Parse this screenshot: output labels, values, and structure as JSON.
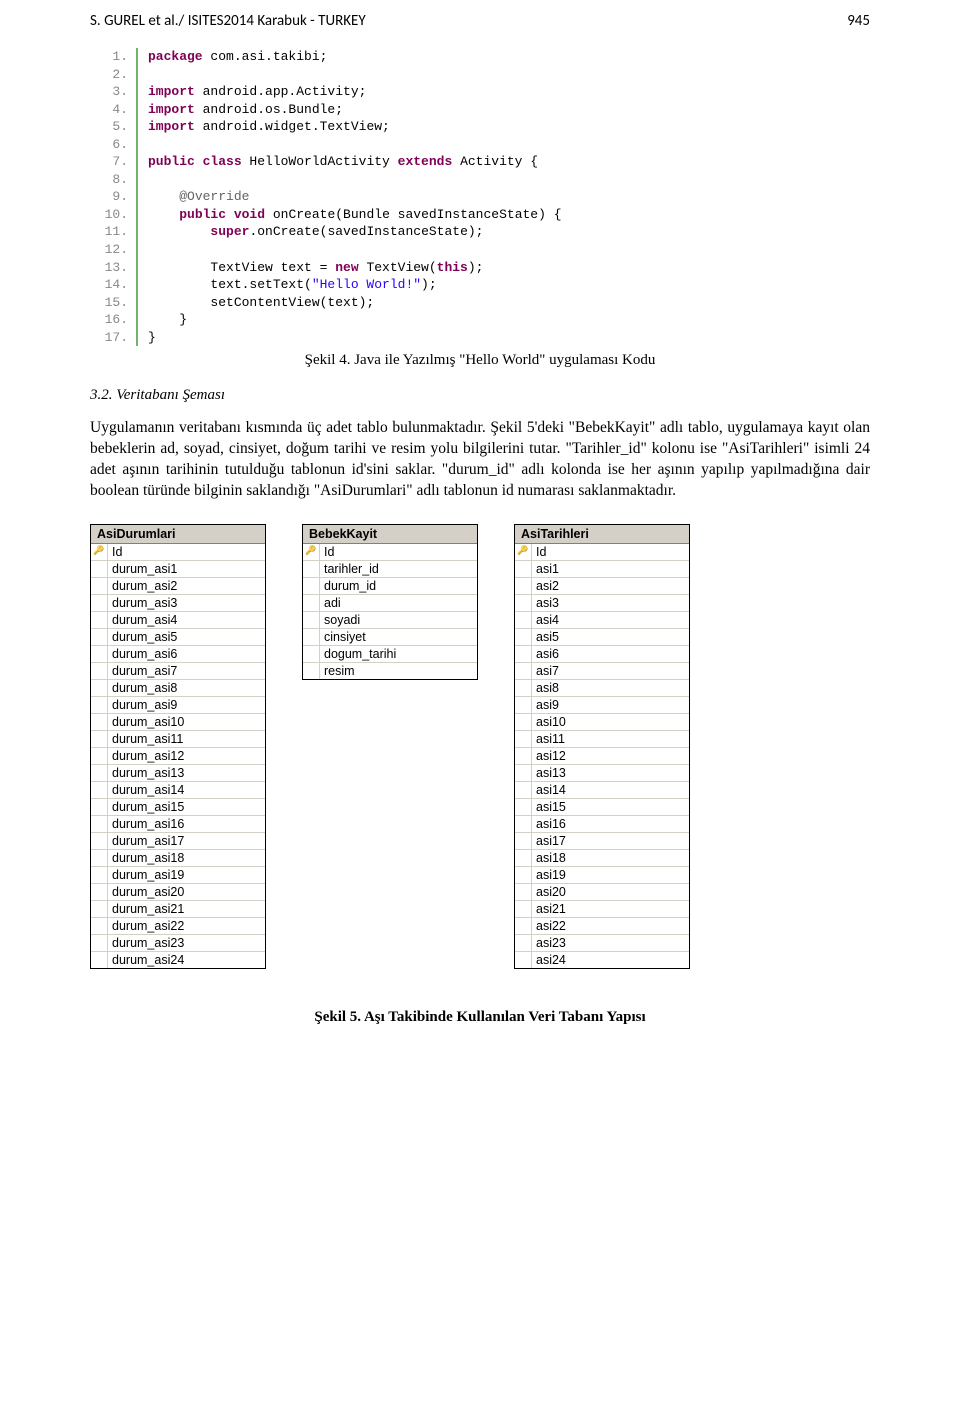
{
  "header": {
    "left": "S. GUREL et al./ ISITES2014 Karabuk - TURKEY",
    "right": "945"
  },
  "code": {
    "lines": [
      {
        "n": "1.",
        "html": "<span class='kw-b'>package</span> com.asi.takibi;"
      },
      {
        "n": "2.",
        "html": ""
      },
      {
        "n": "3.",
        "html": "<span class='kw-b'>import</span> android.app.Activity;"
      },
      {
        "n": "4.",
        "html": "<span class='kw-b'>import</span> android.os.Bundle;"
      },
      {
        "n": "5.",
        "html": "<span class='kw-b'>import</span> android.widget.TextView;"
      },
      {
        "n": "6.",
        "html": ""
      },
      {
        "n": "7.",
        "html": "<span class='kw-b'>public class</span> HelloWorldActivity <span class='kw-b'>extends</span> Activity {"
      },
      {
        "n": "8.",
        "html": ""
      },
      {
        "n": "9.",
        "html": "    <span class='ann'>@Override</span>"
      },
      {
        "n": "10.",
        "html": "    <span class='kw-b'>public void</span> onCreate(Bundle savedInstanceState) {"
      },
      {
        "n": "11.",
        "html": "        <span class='kw-b'>super</span>.onCreate(savedInstanceState);"
      },
      {
        "n": "12.",
        "html": ""
      },
      {
        "n": "13.",
        "html": "        TextView text = <span class='kw-b'>new</span> TextView(<span class='kw-b'>this</span>);"
      },
      {
        "n": "14.",
        "html": "        text.setText(<span class='str'>\"Hello World!\"</span>);"
      },
      {
        "n": "15.",
        "html": "        setContentView(text);"
      },
      {
        "n": "16.",
        "html": "    }"
      },
      {
        "n": "17.",
        "html": "}"
      }
    ]
  },
  "caption_fig4": "Şekil 4. Java ile Yazılmış \"Hello World\" uygulaması Kodu",
  "section_heading": "3.2. Veritabanı Şeması",
  "paragraph": "Uygulamanın veritabanı kısmında üç adet tablo bulunmaktadır. Şekil 5'deki \"BebekKayit\" adlı tablo, uygulamaya kayıt olan bebeklerin ad, soyad, cinsiyet, doğum tarihi ve resim yolu bilgilerini tutar. \"Tarihler_id\" kolonu ise \"AsiTarihleri\" isimli 24 adet aşının tarihinin tutulduğu tablonun id'sini saklar. \"durum_id\" adlı kolonda ise her aşının yapılıp yapılmadığına dair boolean türünde bilginin saklandığı \"AsiDurumlari\" adlı tablonun id numarası saklanmaktadır.",
  "tables": {
    "asidurumlari": {
      "title": "AsiDurumlari",
      "rows": [
        {
          "pk": true,
          "name": "Id"
        },
        {
          "pk": false,
          "name": "durum_asi1"
        },
        {
          "pk": false,
          "name": "durum_asi2"
        },
        {
          "pk": false,
          "name": "durum_asi3"
        },
        {
          "pk": false,
          "name": "durum_asi4"
        },
        {
          "pk": false,
          "name": "durum_asi5"
        },
        {
          "pk": false,
          "name": "durum_asi6"
        },
        {
          "pk": false,
          "name": "durum_asi7"
        },
        {
          "pk": false,
          "name": "durum_asi8"
        },
        {
          "pk": false,
          "name": "durum_asi9"
        },
        {
          "pk": false,
          "name": "durum_asi10"
        },
        {
          "pk": false,
          "name": "durum_asi11"
        },
        {
          "pk": false,
          "name": "durum_asi12"
        },
        {
          "pk": false,
          "name": "durum_asi13"
        },
        {
          "pk": false,
          "name": "durum_asi14"
        },
        {
          "pk": false,
          "name": "durum_asi15"
        },
        {
          "pk": false,
          "name": "durum_asi16"
        },
        {
          "pk": false,
          "name": "durum_asi17"
        },
        {
          "pk": false,
          "name": "durum_asi18"
        },
        {
          "pk": false,
          "name": "durum_asi19"
        },
        {
          "pk": false,
          "name": "durum_asi20"
        },
        {
          "pk": false,
          "name": "durum_asi21"
        },
        {
          "pk": false,
          "name": "durum_asi22"
        },
        {
          "pk": false,
          "name": "durum_asi23"
        },
        {
          "pk": false,
          "name": "durum_asi24"
        }
      ]
    },
    "bebekkayit": {
      "title": "BebekKayit",
      "rows": [
        {
          "pk": true,
          "name": "Id"
        },
        {
          "pk": false,
          "name": "tarihler_id"
        },
        {
          "pk": false,
          "name": "durum_id"
        },
        {
          "pk": false,
          "name": "adi"
        },
        {
          "pk": false,
          "name": "soyadi"
        },
        {
          "pk": false,
          "name": "cinsiyet"
        },
        {
          "pk": false,
          "name": "dogum_tarihi"
        },
        {
          "pk": false,
          "name": "resim"
        }
      ]
    },
    "asitarihleri": {
      "title": "AsiTarihleri",
      "rows": [
        {
          "pk": true,
          "name": "Id"
        },
        {
          "pk": false,
          "name": "asi1"
        },
        {
          "pk": false,
          "name": "asi2"
        },
        {
          "pk": false,
          "name": "asi3"
        },
        {
          "pk": false,
          "name": "asi4"
        },
        {
          "pk": false,
          "name": "asi5"
        },
        {
          "pk": false,
          "name": "asi6"
        },
        {
          "pk": false,
          "name": "asi7"
        },
        {
          "pk": false,
          "name": "asi8"
        },
        {
          "pk": false,
          "name": "asi9"
        },
        {
          "pk": false,
          "name": "asi10"
        },
        {
          "pk": false,
          "name": "asi11"
        },
        {
          "pk": false,
          "name": "asi12"
        },
        {
          "pk": false,
          "name": "asi13"
        },
        {
          "pk": false,
          "name": "asi14"
        },
        {
          "pk": false,
          "name": "asi15"
        },
        {
          "pk": false,
          "name": "asi16"
        },
        {
          "pk": false,
          "name": "asi17"
        },
        {
          "pk": false,
          "name": "asi18"
        },
        {
          "pk": false,
          "name": "asi19"
        },
        {
          "pk": false,
          "name": "asi20"
        },
        {
          "pk": false,
          "name": "asi21"
        },
        {
          "pk": false,
          "name": "asi22"
        },
        {
          "pk": false,
          "name": "asi23"
        },
        {
          "pk": false,
          "name": "asi24"
        }
      ]
    }
  },
  "caption_fig5": "Şekil 5. Aşı Takibinde Kullanılan Veri Tabanı Yapısı"
}
